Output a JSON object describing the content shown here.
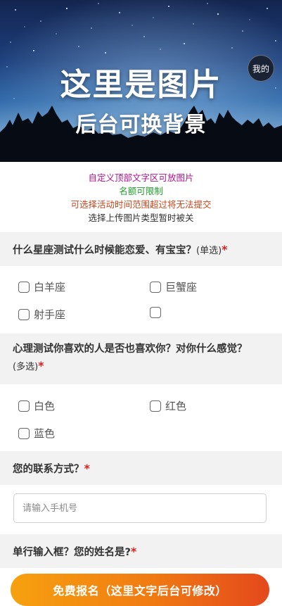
{
  "hero": {
    "title": "这里是图片",
    "subtitle": "后台可换背景",
    "me_label": "我的"
  },
  "notes": [
    {
      "text": "自定义顶部文字区可放图片",
      "color": "#b0138f"
    },
    {
      "text": "名额可限制",
      "color": "#1f9b2c"
    },
    {
      "text": "可选择活动时间范围超过将无法提交",
      "color": "#c6461b"
    },
    {
      "text": "选择上传图片类型暂时被关",
      "color": "#333333"
    }
  ],
  "q1": {
    "title": "什么星座测试什么时候能恋爱、有宝宝？",
    "tag": "(单选)",
    "required_mark": "*",
    "options": [
      "白羊座",
      "巨蟹座",
      "射手座",
      ""
    ]
  },
  "q2": {
    "title": "心理测试你喜欢的人是否也喜欢你？对你什么感觉？",
    "tag": "(多选)",
    "required_mark": "*",
    "options": [
      "白色",
      "红色",
      "蓝色"
    ]
  },
  "q3": {
    "title": "您的联系方式？",
    "required_mark": "*",
    "placeholder": "请输入手机号"
  },
  "q4": {
    "title": "单行输入框？您的姓名是?",
    "required_mark": "*"
  },
  "submit": {
    "label": "免费报名（这里文字后台可修改）"
  }
}
